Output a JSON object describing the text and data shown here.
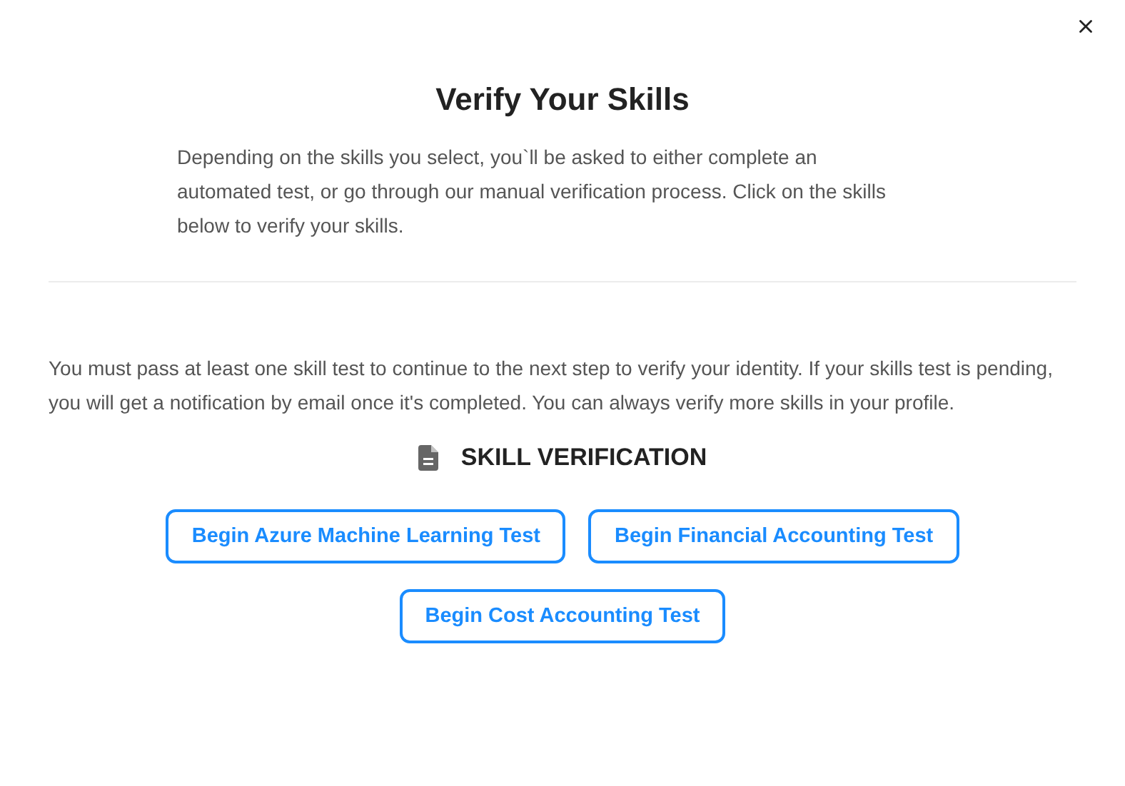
{
  "title": "Verify Your Skills",
  "intro": "Depending on the skills you select, you`ll be asked to either complete an automated test, or go through our manual verification process. Click on the skills below to verify your skills.",
  "notice": "You must pass at least one skill test to continue to the next step to verify your identity. If your skills test is pending, you will get a notification by email once it's completed. You can always verify more skills in your profile.",
  "section_heading": "SKILL VERIFICATION",
  "buttons": [
    "Begin Azure Machine Learning Test",
    "Begin Financial Accounting Test",
    "Begin Cost Accounting Test"
  ]
}
